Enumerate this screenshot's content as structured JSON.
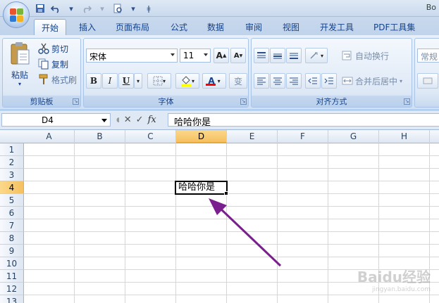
{
  "title_partial": "Bo",
  "tabs": [
    {
      "label": "开始",
      "active": true
    },
    {
      "label": "插入"
    },
    {
      "label": "页面布局"
    },
    {
      "label": "公式"
    },
    {
      "label": "数据"
    },
    {
      "label": "审阅"
    },
    {
      "label": "视图"
    },
    {
      "label": "开发工具"
    },
    {
      "label": "PDF工具集"
    }
  ],
  "clipboard": {
    "paste": "粘贴",
    "cut": "剪切",
    "copy": "复制",
    "format_painter": "格式刷",
    "group": "剪贴板"
  },
  "font": {
    "name": "宋体",
    "size": "11",
    "group": "字体",
    "bold": "B",
    "italic": "I",
    "underline": "U",
    "grow": "A",
    "shrink": "A",
    "font_color": "A",
    "phonetic": "变"
  },
  "alignment": {
    "wrap": "自动换行",
    "merge": "合并后居中",
    "group": "对齐方式"
  },
  "number": {
    "format": "常规"
  },
  "formula_bar": {
    "cell_ref": "D4",
    "fx": "fx",
    "value": "哈哈你是"
  },
  "columns": [
    "A",
    "B",
    "C",
    "D",
    "E",
    "F",
    "G",
    "H"
  ],
  "rows": [
    "1",
    "2",
    "3",
    "4",
    "5",
    "6",
    "7",
    "8",
    "9",
    "10",
    "11",
    "12",
    "13"
  ],
  "active_cell": {
    "ref": "D4",
    "value": "哈哈你是"
  },
  "watermark": {
    "text": "Baidu经验",
    "sub": "jingyan.baidu.com"
  },
  "colors": {
    "accent_selected": "#f5c060",
    "arrow": "#7a1f8e",
    "font_color_bar": "#ff0000"
  }
}
